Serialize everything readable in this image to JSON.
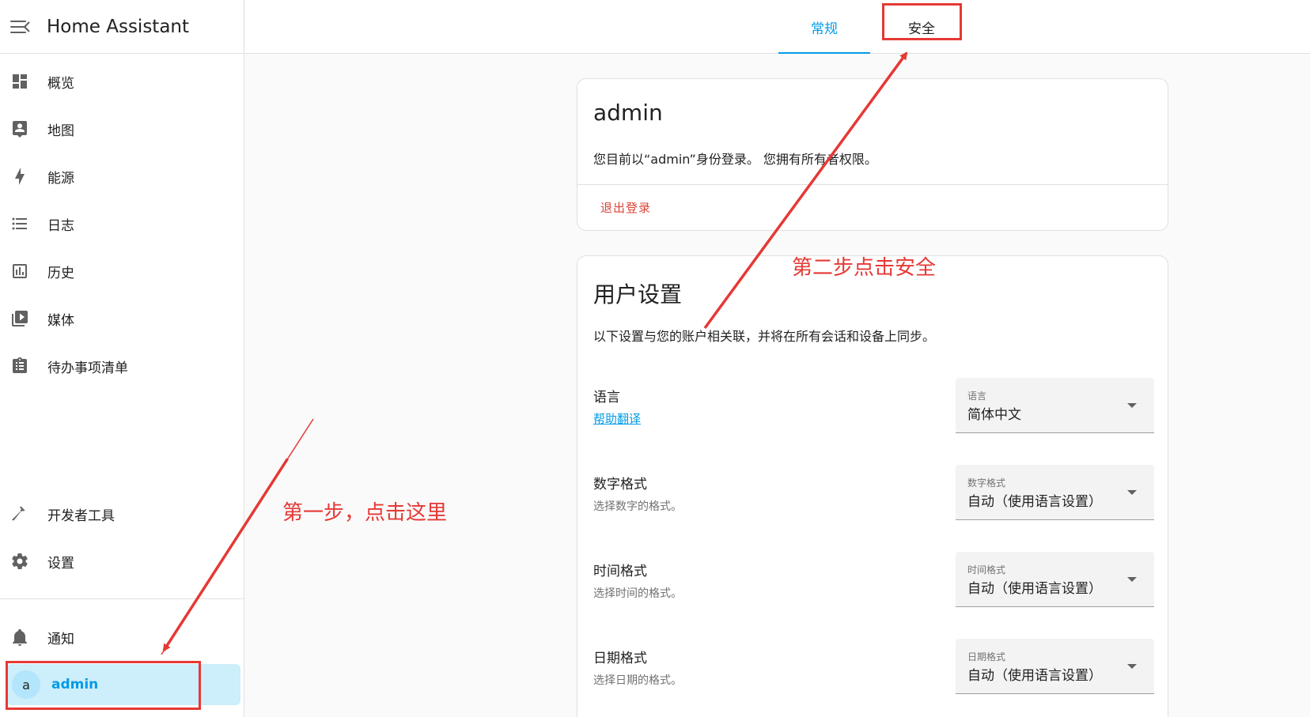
{
  "app": {
    "title": "Home Assistant"
  },
  "sidebar": {
    "items": [
      {
        "label": "概览",
        "icon": "dashboard-icon"
      },
      {
        "label": "地图",
        "icon": "map-account-icon"
      },
      {
        "label": "能源",
        "icon": "lightning-bolt-icon"
      },
      {
        "label": "日志",
        "icon": "list-icon"
      },
      {
        "label": "历史",
        "icon": "chart-box-icon"
      },
      {
        "label": "媒体",
        "icon": "play-box-multiple-icon"
      },
      {
        "label": "待办事项清单",
        "icon": "clipboard-list-icon"
      }
    ],
    "bottom_items": [
      {
        "label": "开发者工具",
        "icon": "hammer-icon"
      },
      {
        "label": "设置",
        "icon": "gear-icon"
      }
    ],
    "notifications": {
      "label": "通知",
      "icon": "bell-icon"
    },
    "user": {
      "avatar_letter": "a",
      "label": "admin"
    }
  },
  "tabs": {
    "general": "常规",
    "security": "安全",
    "active": "general"
  },
  "account_card": {
    "title": "admin",
    "description": "您目前以“admin”身份登录。 您拥有所有者权限。",
    "logout": "退出登录"
  },
  "settings_card": {
    "title": "用户设置",
    "description": "以下设置与您的账户相关联，并将在所有会话和设备上同步。",
    "rows": [
      {
        "label": "语言",
        "link": "帮助翻译",
        "select_label": "语言",
        "select_value": "简体中文"
      },
      {
        "label": "数字格式",
        "sub": "选择数字的格式。",
        "select_label": "数字格式",
        "select_value": "自动（使用语言设置）"
      },
      {
        "label": "时间格式",
        "sub": "选择时间的格式。",
        "select_label": "时间格式",
        "select_value": "自动（使用语言设置）"
      },
      {
        "label": "日期格式",
        "sub": "选择日期的格式。",
        "select_label": "日期格式",
        "select_value": "自动（使用语言设置）"
      }
    ]
  },
  "annotations": {
    "step1": "第一步，点击这里",
    "step2": "第二步点击安全",
    "color": "#e53935"
  },
  "colors": {
    "accent": "#039be5",
    "logout": "#db4437",
    "selected_bg": "#cdeefb"
  }
}
